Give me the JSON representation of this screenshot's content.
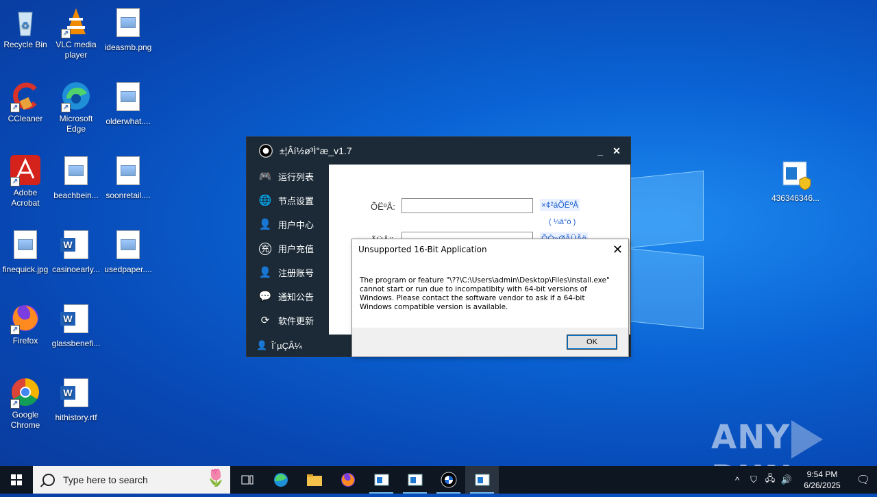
{
  "desktop": {
    "icons": [
      {
        "label": "Recycle Bin"
      },
      {
        "label": "VLC media player"
      },
      {
        "label": "ideasmb.png"
      },
      {
        "label": "CCleaner"
      },
      {
        "label": "Microsoft Edge"
      },
      {
        "label": "olderwhat...."
      },
      {
        "label": "Adobe Acrobat"
      },
      {
        "label": "beachbein..."
      },
      {
        "label": "soonretail...."
      },
      {
        "label": "finequick.jpg"
      },
      {
        "label": "casinoearly..."
      },
      {
        "label": "usedpaper...."
      },
      {
        "label": "Firefox"
      },
      {
        "label": "glassbenefi..."
      },
      {
        "label": "Google Chrome"
      },
      {
        "label": "hithistory.rtf"
      },
      {
        "label": "436346346..."
      }
    ]
  },
  "app": {
    "title": "±¦Âí½ø³Ì°æ_v1.7",
    "minimize": "_",
    "close": "✕",
    "sidebar": [
      {
        "label": "运行列表",
        "icon": "gamepad-icon"
      },
      {
        "label": "节点设置",
        "icon": "globe-icon"
      },
      {
        "label": "用户中心",
        "icon": "user-icon"
      },
      {
        "label": "用户充值",
        "icon": "recharge-icon"
      },
      {
        "label": "注册账号",
        "icon": "register-icon"
      },
      {
        "label": "通知公告",
        "icon": "wechat-icon"
      },
      {
        "label": "软件更新",
        "icon": "refresh-icon"
      }
    ],
    "bottom_user": "Î´µÇÂ¼",
    "form": {
      "account_label": "ÕËºÅ:",
      "account_link": "×¢²áÕËºÅ",
      "small_link": "( ¼â°ó )",
      "password_label": "ÃÜÂë:",
      "password_link": "ÕÒ»ØÃÜÂë"
    }
  },
  "dialog": {
    "title": "Unsupported 16-Bit Application",
    "close": "✕",
    "message": "The program or feature \"\\??\\C:\\Users\\admin\\Desktop\\Files\\install.exe\" cannot start or run due to incompatibity with 64-bit versions of Windows. Please contact the software vendor to ask if a 64-bit Windows compatible version is available.",
    "ok": "OK"
  },
  "watermark": {
    "left": "ANY",
    "right": "RUN"
  },
  "taskbar": {
    "search_placeholder": "Type here to search",
    "time": "9:54 PM",
    "date": "6/26/2025",
    "apps": [
      "task-view-icon",
      "edge-icon",
      "file-explorer-icon",
      "firefox-icon",
      "window-app-icon",
      "window-app-icon",
      "bmw-app-icon",
      "window-app-icon"
    ]
  }
}
